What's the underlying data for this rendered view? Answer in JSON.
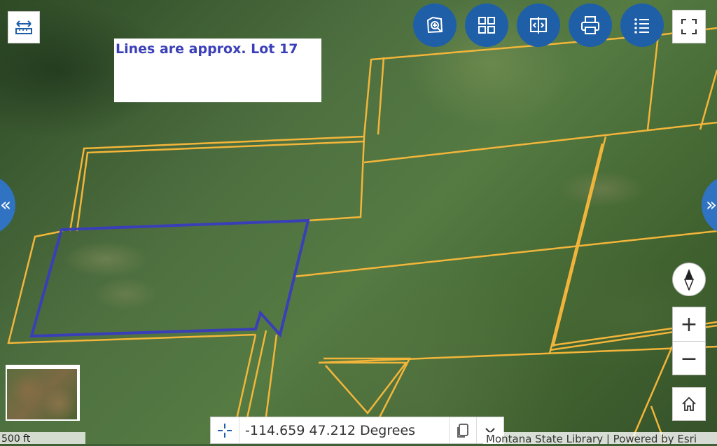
{
  "map": {
    "annotation_text": "Lines are approx. Lot 17",
    "parcel_line_color": "#f3b63a",
    "lot_outline_color": "#3a3fb8"
  },
  "toolbar": {
    "buttons": [
      {
        "name": "zoom-to-area",
        "icon": "search-map-icon"
      },
      {
        "name": "basemap-gallery",
        "icon": "grid-icon"
      },
      {
        "name": "swipe",
        "icon": "swipe-icon"
      },
      {
        "name": "print",
        "icon": "print-icon"
      },
      {
        "name": "legend",
        "icon": "list-icon"
      }
    ],
    "accent_color": "#1f5fa8"
  },
  "controls": {
    "zoom_in": "+",
    "zoom_out": "−",
    "left_tab": "«",
    "right_tab": "»"
  },
  "scale": {
    "label": "500 ft"
  },
  "coordinates": {
    "text": "-114.659 47.212 Degrees"
  },
  "attribution": {
    "text": "Montana State Library | Powered by Esri"
  }
}
